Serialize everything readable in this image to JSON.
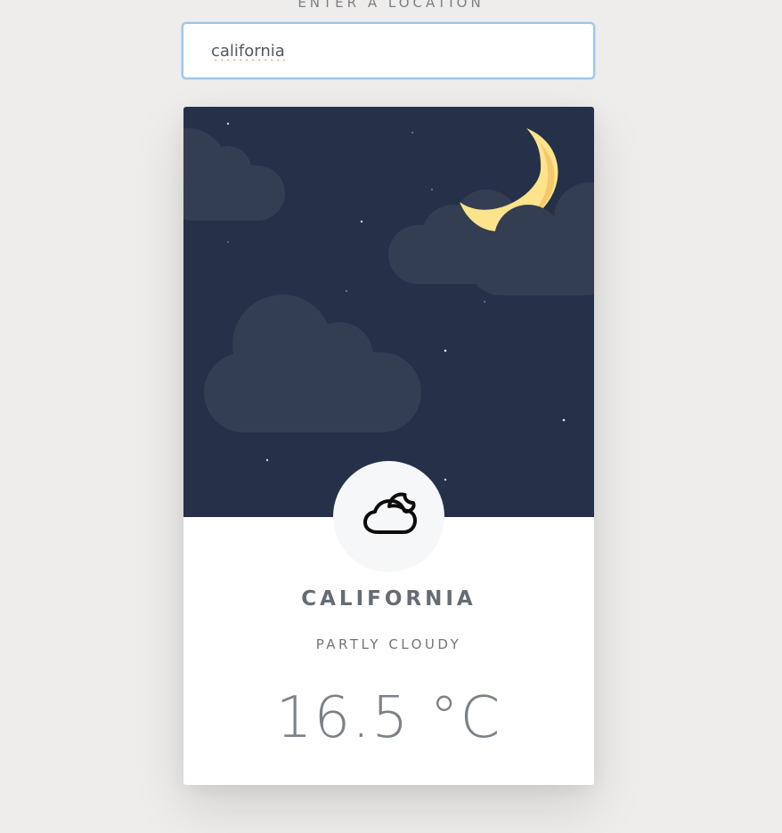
{
  "search": {
    "label": "ENTER A LOCATION",
    "value": "california"
  },
  "weather": {
    "city": "CALIFORNIA",
    "condition": "PARTLY CLOUDY",
    "temperature": "16.5 °C",
    "icon": "partly-cloudy-night-icon"
  },
  "colors": {
    "page_background": "#eeedeb",
    "sky": "#253149",
    "cloud": "#333e52",
    "moon": "#fde38b",
    "moon_shade": "#f5c96a",
    "badge": "#f6f7f9",
    "input_focus": "#9cc6f0",
    "text": "#646c75"
  }
}
